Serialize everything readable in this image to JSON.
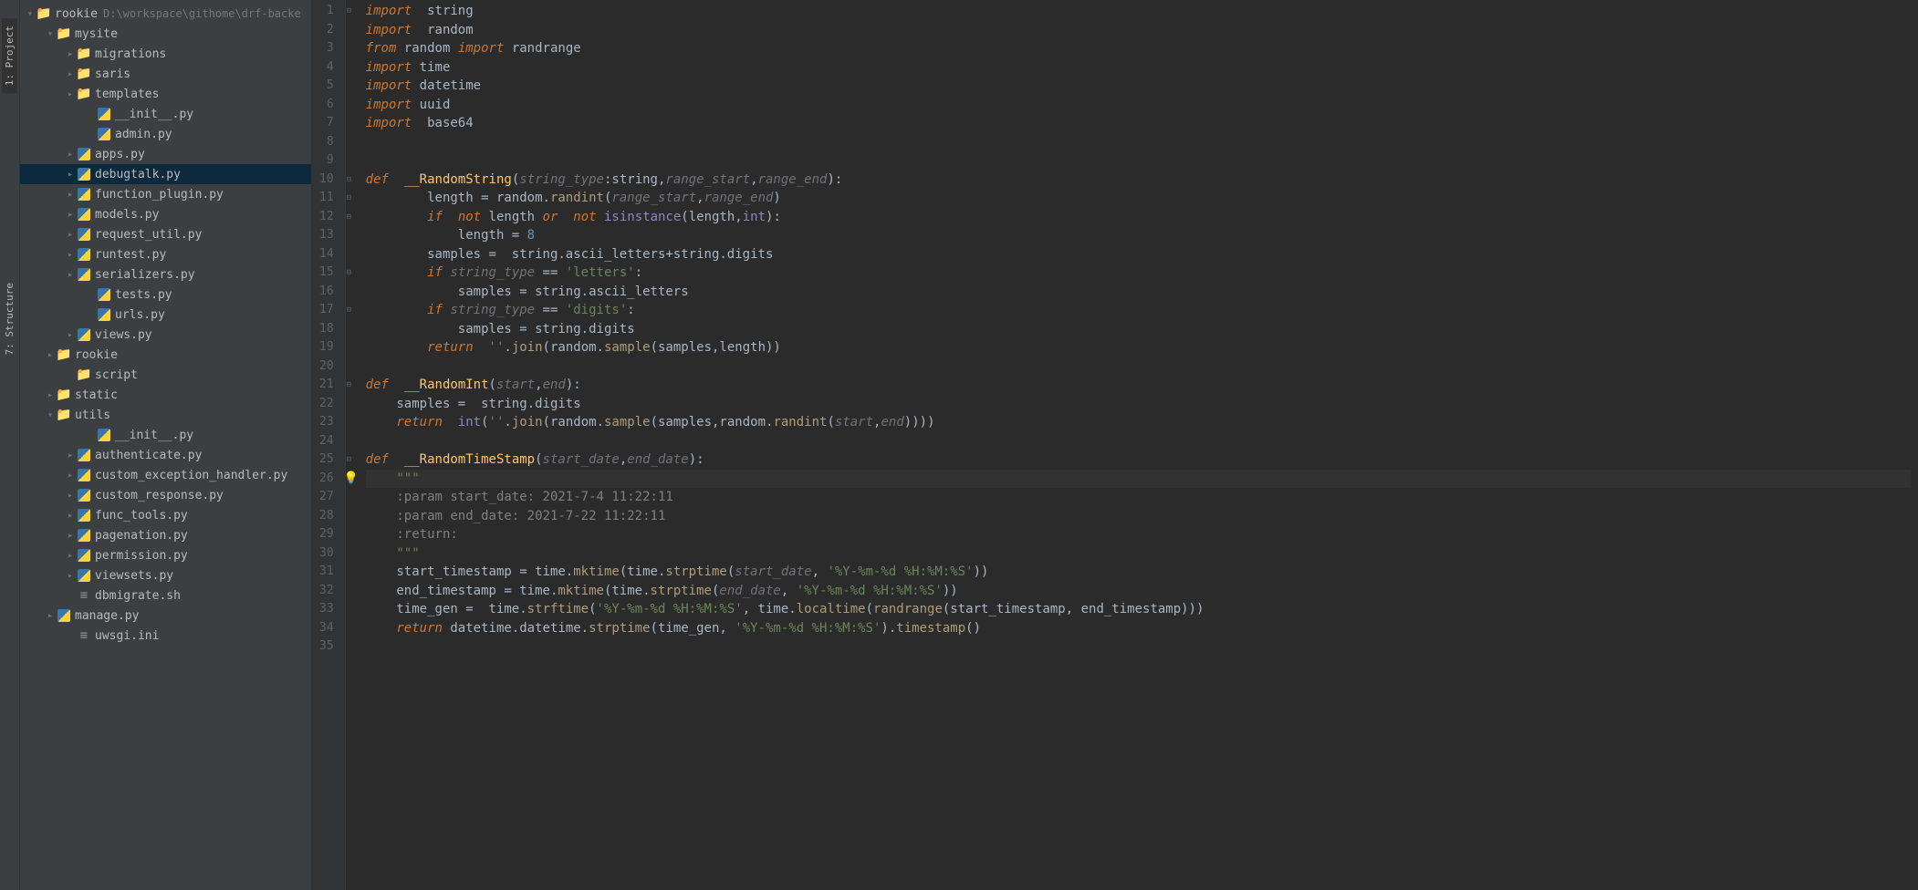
{
  "left_tabs": {
    "project": "1: Project",
    "structure": "7: Structure"
  },
  "tree": {
    "root": {
      "name": "rookie",
      "path": "D:\\workspace\\githome\\drf-backe"
    },
    "items": [
      {
        "indent": 1,
        "chev": "down",
        "icon": "folder",
        "label": "mysite"
      },
      {
        "indent": 2,
        "chev": "right",
        "icon": "folder",
        "label": "migrations"
      },
      {
        "indent": 2,
        "chev": "right",
        "icon": "folder",
        "label": "saris"
      },
      {
        "indent": 2,
        "chev": "right",
        "icon": "folder",
        "label": "templates"
      },
      {
        "indent": 3,
        "chev": "",
        "icon": "py",
        "label": "__init__.py"
      },
      {
        "indent": 3,
        "chev": "",
        "icon": "py",
        "label": "admin.py"
      },
      {
        "indent": 2,
        "chev": "right",
        "icon": "py",
        "label": "apps.py"
      },
      {
        "indent": 2,
        "chev": "right",
        "icon": "py",
        "label": "debugtalk.py",
        "selected": true
      },
      {
        "indent": 2,
        "chev": "right",
        "icon": "py",
        "label": "function_plugin.py"
      },
      {
        "indent": 2,
        "chev": "right",
        "icon": "py",
        "label": "models.py"
      },
      {
        "indent": 2,
        "chev": "right",
        "icon": "py",
        "label": "request_util.py"
      },
      {
        "indent": 2,
        "chev": "right",
        "icon": "py",
        "label": "runtest.py"
      },
      {
        "indent": 2,
        "chev": "right",
        "icon": "py",
        "label": "serializers.py"
      },
      {
        "indent": 3,
        "chev": "",
        "icon": "py",
        "label": "tests.py"
      },
      {
        "indent": 3,
        "chev": "",
        "icon": "py",
        "label": "urls.py"
      },
      {
        "indent": 2,
        "chev": "right",
        "icon": "py",
        "label": "views.py"
      },
      {
        "indent": 1,
        "chev": "right",
        "icon": "folder",
        "label": "rookie"
      },
      {
        "indent": 2,
        "chev": "",
        "icon": "folder",
        "label": "script"
      },
      {
        "indent": 1,
        "chev": "right",
        "icon": "folder",
        "label": "static"
      },
      {
        "indent": 1,
        "chev": "down",
        "icon": "folder",
        "label": "utils"
      },
      {
        "indent": 3,
        "chev": "",
        "icon": "py",
        "label": "__init__.py"
      },
      {
        "indent": 2,
        "chev": "right",
        "icon": "py",
        "label": "authenticate.py"
      },
      {
        "indent": 2,
        "chev": "right",
        "icon": "py",
        "label": "custom_exception_handler.py"
      },
      {
        "indent": 2,
        "chev": "right",
        "icon": "py",
        "label": "custom_response.py"
      },
      {
        "indent": 2,
        "chev": "right",
        "icon": "py",
        "label": "func_tools.py"
      },
      {
        "indent": 2,
        "chev": "right",
        "icon": "py",
        "label": "pagenation.py"
      },
      {
        "indent": 2,
        "chev": "right",
        "icon": "py",
        "label": "permission.py"
      },
      {
        "indent": 2,
        "chev": "right",
        "icon": "py",
        "label": "viewsets.py"
      },
      {
        "indent": 2,
        "chev": "",
        "icon": "file",
        "label": "dbmigrate.sh"
      },
      {
        "indent": 1,
        "chev": "right",
        "icon": "py",
        "label": "manage.py"
      },
      {
        "indent": 2,
        "chev": "",
        "icon": "file",
        "label": "uwsgi.ini"
      }
    ]
  },
  "code": {
    "lines": [
      {
        "n": 1,
        "html": "<span class='kw'>import</span>  string"
      },
      {
        "n": 2,
        "html": "<span class='kw'>import</span>  random"
      },
      {
        "n": 3,
        "html": "<span class='kw'>from</span> random <span class='kw'>import</span> randrange"
      },
      {
        "n": 4,
        "html": "<span class='kw'>import</span> time"
      },
      {
        "n": 5,
        "html": "<span class='kw'>import</span> datetime"
      },
      {
        "n": 6,
        "html": "<span class='kw'>import</span> uuid"
      },
      {
        "n": 7,
        "html": "<span class='kw'>import</span>  base64"
      },
      {
        "n": 8,
        "html": ""
      },
      {
        "n": 9,
        "html": ""
      },
      {
        "n": 10,
        "html": "<span class='kw'>def</span>  <span class='def-name'>__RandomString</span>(<span class='param'>string_type</span>:string,<span class='param'>range_start</span>,<span class='param'>range_end</span>):"
      },
      {
        "n": 11,
        "html": "        length = random.<span class='call'>randint</span>(<span class='param'>range_start</span>,<span class='param'>range_end</span>)"
      },
      {
        "n": 12,
        "html": "        <span class='kw'>if</span>  <span class='kw'>not</span> length <span class='kw'>or</span>  <span class='kw'>not</span> <span class='bi'>isinstance</span>(length,<span class='bi'>int</span>):"
      },
      {
        "n": 13,
        "html": "            length = <span class='num'>8</span>"
      },
      {
        "n": 14,
        "html": "        samples =  string.ascii_letters+string.digits"
      },
      {
        "n": 15,
        "html": "        <span class='kw'>if</span> <span class='param'>string_type</span> == <span class='str'>'letters'</span>:"
      },
      {
        "n": 16,
        "html": "            samples = string.ascii_letters"
      },
      {
        "n": 17,
        "html": "        <span class='kw'>if</span> <span class='param'>string_type</span> == <span class='str'>'digits'</span>:"
      },
      {
        "n": 18,
        "html": "            samples = string.digits"
      },
      {
        "n": 19,
        "html": "        <span class='kw'>return</span>  <span class='str'>''</span>.<span class='call'>join</span>(random.<span class='call'>sample</span>(samples,length))"
      },
      {
        "n": 20,
        "html": ""
      },
      {
        "n": 21,
        "html": "<span class='kw'>def</span>  <span class='def-name'>__RandomInt</span>(<span class='param'>start</span>,<span class='param'>end</span>):"
      },
      {
        "n": 22,
        "html": "    samples =  string.digits"
      },
      {
        "n": 23,
        "html": "    <span class='kw'>return</span>  <span class='bi'>int</span>(<span class='str'>''</span>.<span class='call'>join</span>(random.<span class='call'>sample</span>(samples,random.<span class='call'>randint</span>(<span class='param'>start</span>,<span class='param'>end</span>))))"
      },
      {
        "n": 24,
        "html": ""
      },
      {
        "n": 25,
        "html": "<span class='kw'>def</span>  <span class='def-name'>__RandomTimeStamp</span>(<span class='param'>start_date</span>,<span class='param'>end_date</span>):"
      },
      {
        "n": 26,
        "html": "    <span class='str'>\"\"\"</span>",
        "hl": true
      },
      {
        "n": 27,
        "html": "<span class='cmt'>    :param start_date: 2021-7-4 11:22:11</span>"
      },
      {
        "n": 28,
        "html": "<span class='cmt'>    :param end_date: 2021-7-22 11:22:11</span>"
      },
      {
        "n": 29,
        "html": "<span class='cmt'>    :return:</span>"
      },
      {
        "n": 30,
        "html": "    <span class='str'>\"\"\"</span>"
      },
      {
        "n": 31,
        "html": "    start_timestamp = time.<span class='call'>mktime</span>(time.<span class='call'>strptime</span>(<span class='param'>start_date</span>, <span class='str'>'%Y-%m-%d %H:%M:%S'</span>))"
      },
      {
        "n": 32,
        "html": "    end_timestamp = time.<span class='call'>mktime</span>(time.<span class='call'>strptime</span>(<span class='param'>end_date</span>, <span class='str'>'%Y-%m-%d %H:%M:%S'</span>))"
      },
      {
        "n": 33,
        "html": "    time_gen =  time.<span class='call'>strftime</span>(<span class='str'>'%Y-%m-%d %H:%M:%S'</span>, time.<span class='call'>localtime</span>(<span class='call'>randrange</span>(start_timestamp, end_timestamp)))"
      },
      {
        "n": 34,
        "html": "    <span class='kw'>return</span> datetime.datetime.<span class='call'>strptime</span>(time_gen, <span class='str'>'%Y-%m-%d %H:%M:%S'</span>).<span class='call'>timestamp</span>()"
      },
      {
        "n": 35,
        "html": ""
      }
    ]
  }
}
